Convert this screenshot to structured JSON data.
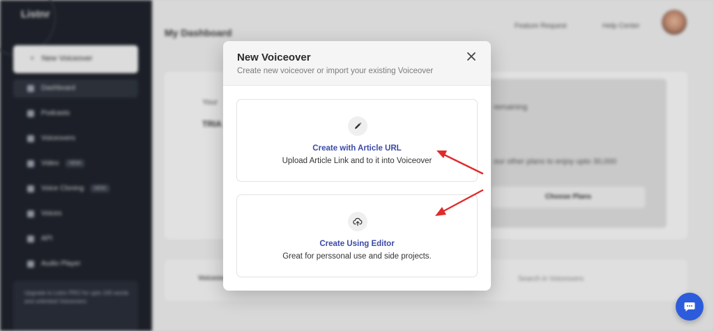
{
  "background": {
    "brand": "Listnr",
    "new_button": "New Voiceover",
    "nav": [
      {
        "label": "Dashboard",
        "badge": ""
      },
      {
        "label": "Podcasts",
        "badge": ""
      },
      {
        "label": "Voiceovers",
        "badge": ""
      },
      {
        "label": "Video",
        "badge": "NEW"
      },
      {
        "label": "Voice Cloning",
        "badge": "NEW"
      },
      {
        "label": "Voices",
        "badge": ""
      },
      {
        "label": "API",
        "badge": ""
      },
      {
        "label": "Audio Player",
        "badge": ""
      }
    ],
    "promo": "Upgrade to Listnr PRO for upto 100 words and unlimited Voiceovers",
    "page_title": "My Dashboard",
    "top_links": [
      "Feature Request",
      "Help Center"
    ],
    "panel_text_1": "Your",
    "panel_text_2": "TRIA",
    "panel_text_3": "remaining",
    "panel_text_4": "our other plans to enjoy upto 30,000",
    "choose_plans": "Choose Plans",
    "lower_label": "Voiceovers",
    "search_placeholder": "Search in Voiceovers"
  },
  "modal": {
    "title": "New Voiceover",
    "subtitle": "Create new voiceover or import your existing Voiceover",
    "close_icon": "close-icon",
    "options": [
      {
        "icon": "pencil-icon",
        "title": "Create with Article URL",
        "description": "Upload Article Link and to it into Voiceover"
      },
      {
        "icon": "upload-cloud-icon",
        "title": "Create Using Editor",
        "description": "Great for perssonal use and side projects."
      }
    ]
  },
  "colors": {
    "accent": "#3a4aa6",
    "arrow": "#e02b2b",
    "chat_fab": "#2c5cdc",
    "sidebar": "#1b1f28"
  },
  "chat_icon": "chat-bubble-icon"
}
